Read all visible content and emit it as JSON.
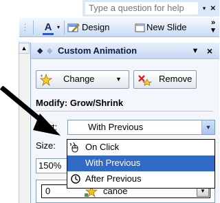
{
  "help": {
    "question_placeholder": "Type a question for help",
    "dropdown_glyph": "▾",
    "close_glyph": "×"
  },
  "toolbar": {
    "grip_glyph": "⋮",
    "font_color_glyph": "A",
    "font_color_dropdown": "▾",
    "design_label": "Design",
    "new_slide_label": "New Slide",
    "more_glyph": "»"
  },
  "pane": {
    "scroll_up_glyph": "▲",
    "back_glyph": "◆",
    "forward_glyph": "◆",
    "title": "Custom Animation",
    "menu_glyph": "▼",
    "close_glyph": "×",
    "change_label": "Change",
    "change_arrow": "▼",
    "remove_label": "Remove",
    "modify_label": "Modify: Grow/Shrink",
    "start_label": "Start:",
    "start_value": "With Previous",
    "start_arrow": "▼",
    "size_label": "Size:",
    "size_value": "150%",
    "list_item": {
      "number": "0",
      "name": "canoe",
      "arrow": "▼"
    }
  },
  "start_dropdown": {
    "options": [
      {
        "label": "On Click",
        "icon": "mouse-icon",
        "selected": false
      },
      {
        "label": "With Previous",
        "icon": "",
        "selected": true
      },
      {
        "label": "After Previous",
        "icon": "clock-icon",
        "selected": false
      }
    ]
  },
  "colors": {
    "selection": "#316ac5",
    "pane_header": "#c7d8f2",
    "title_text": "#0c1b4a"
  }
}
